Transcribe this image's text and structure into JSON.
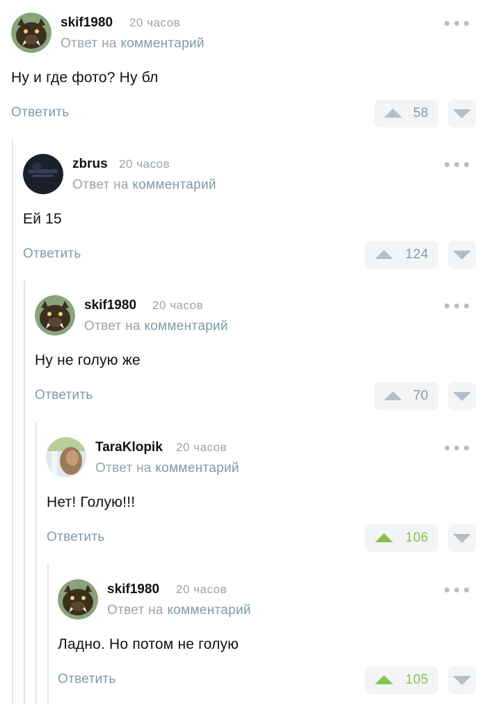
{
  "comments": [
    {
      "username": "skif1980",
      "time": "20 часов",
      "reply_prefix": "Ответ на",
      "reply_link": "комментарий",
      "text": "Ну и где фото? Ну бл",
      "reply_label": "Ответить",
      "votes": "58",
      "upvoted": false,
      "avatar": "boar-avatar"
    },
    {
      "username": "zbrus",
      "time": "20 часов",
      "reply_prefix": "Ответ на",
      "reply_link": "комментарий",
      "text": "Ей 15",
      "reply_label": "Ответить",
      "votes": "124",
      "upvoted": false,
      "avatar": "dark-photo-avatar"
    },
    {
      "username": "skif1980",
      "time": "20 часов",
      "reply_prefix": "Ответ на",
      "reply_link": "комментарий",
      "text": "Ну не голую же",
      "reply_label": "Ответить",
      "votes": "70",
      "upvoted": false,
      "avatar": "boar-avatar"
    },
    {
      "username": "TaraKlopik",
      "time": "20 часов",
      "reply_prefix": "Ответ на",
      "reply_link": "комментарий",
      "text": "Нет! Голую!!!",
      "reply_label": "Ответить",
      "votes": "106",
      "upvoted": true,
      "avatar": "photo-avatar"
    },
    {
      "username": "skif1980",
      "time": "20 часов",
      "reply_prefix": "Ответ на",
      "reply_link": "комментарий",
      "text": "Ладно. Но потом не голую",
      "reply_label": "Ответить",
      "votes": "105",
      "upvoted": true,
      "avatar": "boar-avatar"
    }
  ],
  "colors": {
    "accent_link": "#7f99a6",
    "upvote_green": "#88c34a",
    "muted": "#9aa2a8",
    "thread_line": "#e3e6e8"
  }
}
